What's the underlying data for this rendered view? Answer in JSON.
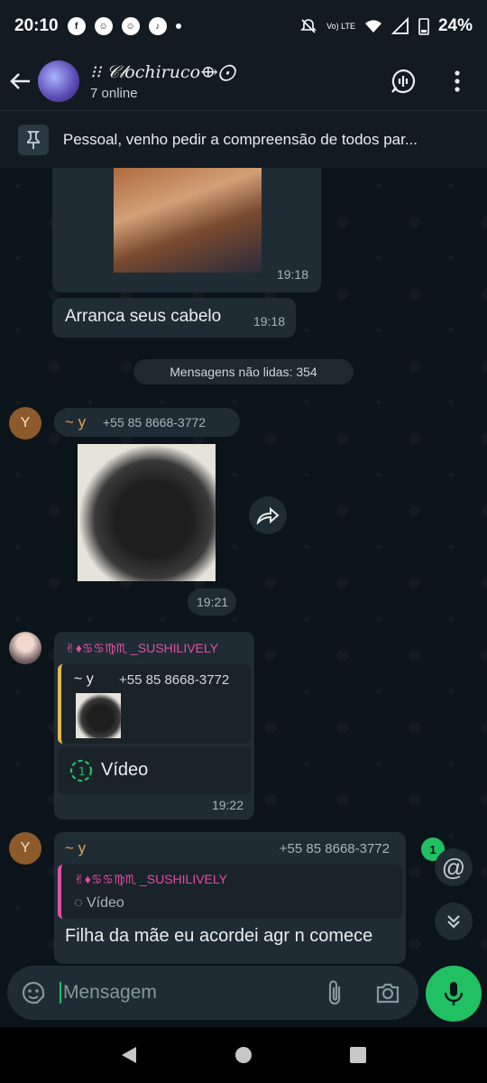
{
  "status_bar": {
    "time": "20:10",
    "notification_icons": [
      "facebook-icon",
      "emoji-icon",
      "emoji-icon",
      "tiktok-icon"
    ],
    "battery": "24%",
    "network": "Vo) LTE"
  },
  "header": {
    "title": "⁝⁝ 𝒞𝓁ochiruco⟴⨀",
    "subtitle": "7 online"
  },
  "pinned": {
    "text": "Pessoal, venho pedir a compreensão de todos par..."
  },
  "messages": {
    "m1": {
      "time": "19:18"
    },
    "m2": {
      "text": "Arranca seus cabelo",
      "time": "19:18"
    },
    "unread_label": "Mensagens não lidas: 354",
    "m3": {
      "avatar": "Y",
      "sender": "~ y",
      "phone": "+55 85 8668-3772",
      "time": "19:21"
    },
    "m4": {
      "sender": "✌︎♦︎♋︎♋︎♍︎♏︎ _SUSHILIVELY",
      "quote_sender": "~ y",
      "quote_phone": "+55 85 8668-3772",
      "video_label": "Vídeo",
      "time": "19:22"
    },
    "m5": {
      "avatar": "Y",
      "sender": "~ y",
      "phone": "+55 85 8668-3772",
      "quote_sender": "✌︎♦︎♋︎♋︎♍︎♏︎ _SUSHILIVELY",
      "quote_text": "Vídeo",
      "text": "Filha da mãe eu acordei agr n comece"
    }
  },
  "floating": {
    "mention_badge": "1"
  },
  "composer": {
    "placeholder": "Mensagem"
  },
  "colors": {
    "accent": "#21c063",
    "bubble": "#202c33",
    "background": "#0b141a"
  }
}
